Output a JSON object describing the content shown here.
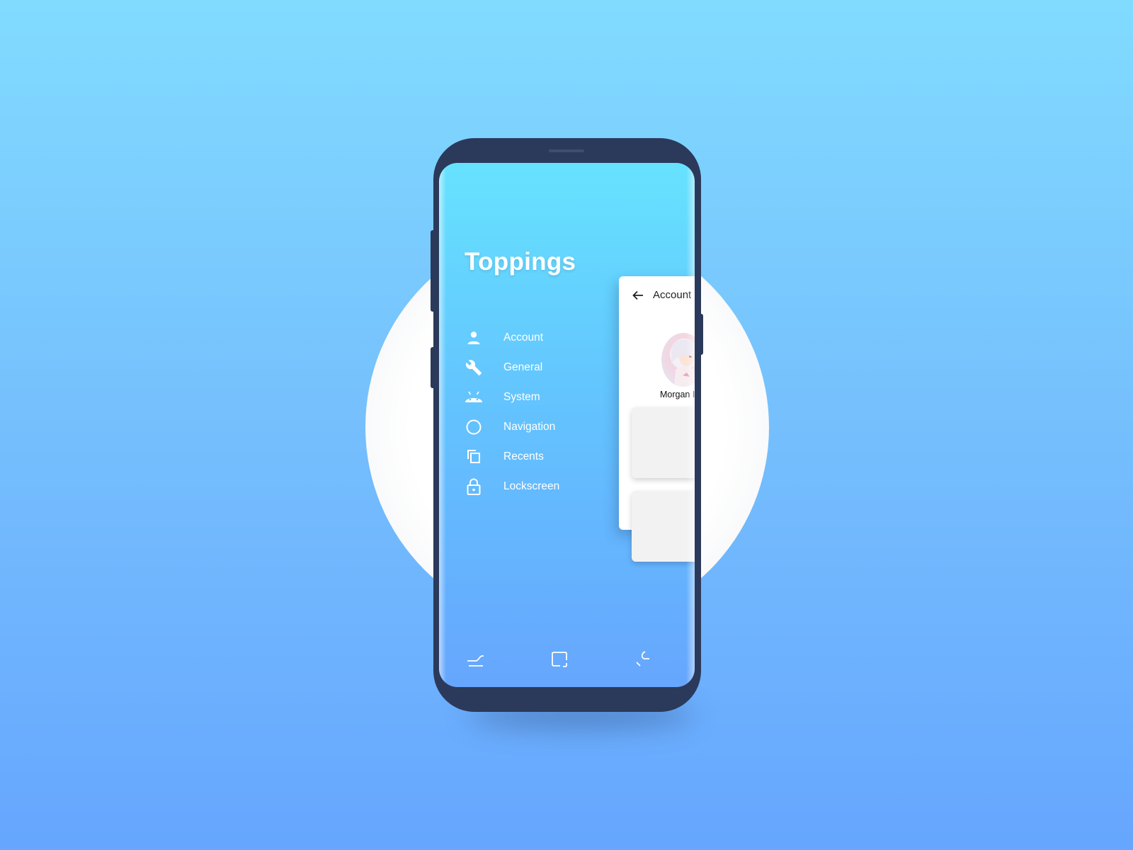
{
  "app": {
    "title": "Toppings"
  },
  "menu": {
    "items": [
      {
        "label": "Account",
        "icon": "person-icon"
      },
      {
        "label": "General",
        "icon": "wrench-icon"
      },
      {
        "label": "System",
        "icon": "android-icon"
      },
      {
        "label": "Navigation",
        "icon": "circle-icon"
      },
      {
        "label": "Recents",
        "icon": "recents-icon"
      },
      {
        "label": "Lockscreen",
        "icon": "lock-icon"
      }
    ]
  },
  "account_panel": {
    "title": "Account",
    "user_name": "Morgan I"
  },
  "nav_bar": {
    "buttons": [
      "back-nav-icon",
      "home-nav-icon",
      "recents-nav-icon"
    ]
  },
  "colors": {
    "background_top": "#81dbff",
    "background_bottom": "#66a6fe",
    "phone_body": "#2b3a5a",
    "screen_top": "#66e2fe",
    "screen_bottom": "#66a6fe",
    "panel": "#ffffff",
    "card": "#f2f2f2"
  }
}
